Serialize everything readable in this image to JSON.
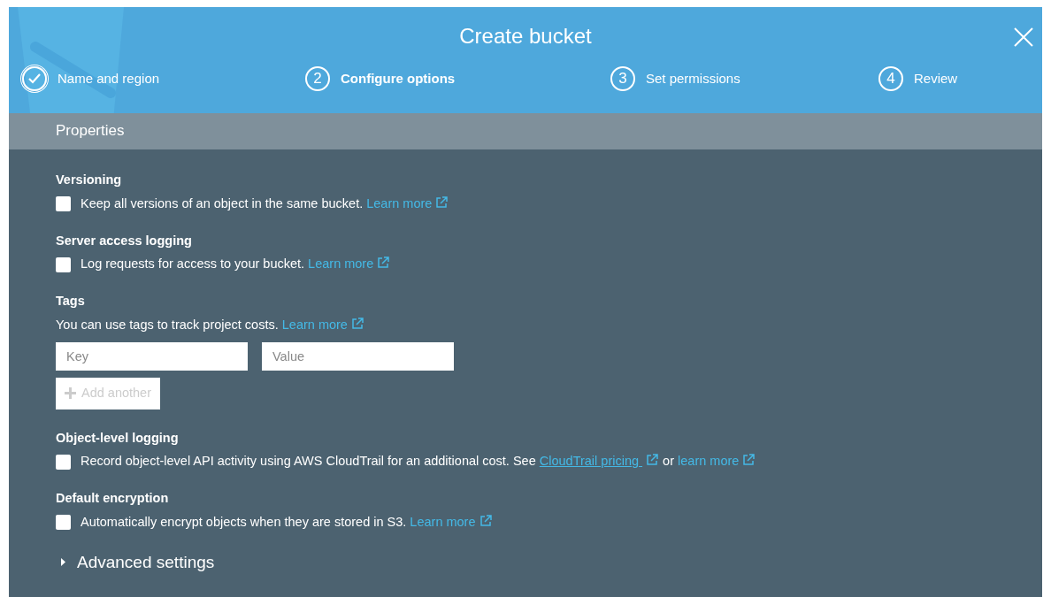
{
  "window": {
    "title": "Create bucket"
  },
  "steps": [
    {
      "label": "Name and region",
      "completed": true,
      "selected": false
    },
    {
      "number": "2",
      "label": "Configure options",
      "completed": false,
      "selected": true
    },
    {
      "number": "3",
      "label": "Set permissions",
      "completed": false,
      "selected": false
    },
    {
      "number": "4",
      "label": "Review",
      "completed": false,
      "selected": false
    }
  ],
  "section_title": "Properties",
  "options": [
    {
      "kind": "checkbox",
      "title": "Versioning",
      "checked": false,
      "description": [
        {
          "text": "Keep all versions of an object in the same bucket. "
        },
        {
          "link": "Learn more",
          "underlined": false
        }
      ]
    },
    {
      "kind": "checkbox",
      "title": "Server access logging",
      "checked": false,
      "description": [
        {
          "text": "Log requests for access to your bucket. "
        },
        {
          "link": "Learn more",
          "underlined": false
        }
      ]
    },
    {
      "kind": "tags",
      "title": "Tags",
      "description": [
        {
          "text": "You can use tags to track project costs. "
        },
        {
          "link": "Learn more",
          "underlined": false
        }
      ],
      "key_placeholder": "Key",
      "value_placeholder": "Value",
      "add_button": {
        "label": "Add another",
        "disabled": true
      }
    },
    {
      "kind": "checkbox",
      "title": "Object-level logging",
      "checked": false,
      "description": [
        {
          "text": "Record object-level API activity using AWS CloudTrail for an additional cost. See "
        },
        {
          "link": "CloudTrail pricing ",
          "underlined": true
        },
        {
          "text": " or "
        },
        {
          "link": "learn more",
          "underlined": false
        }
      ]
    },
    {
      "kind": "checkbox",
      "title": "Default encryption",
      "checked": false,
      "description": [
        {
          "text": "Automatically encrypt objects when they are stored in S3. "
        },
        {
          "link": "Learn more",
          "underlined": false
        }
      ]
    }
  ],
  "advanced": {
    "label": "Advanced settings",
    "expanded": false
  }
}
